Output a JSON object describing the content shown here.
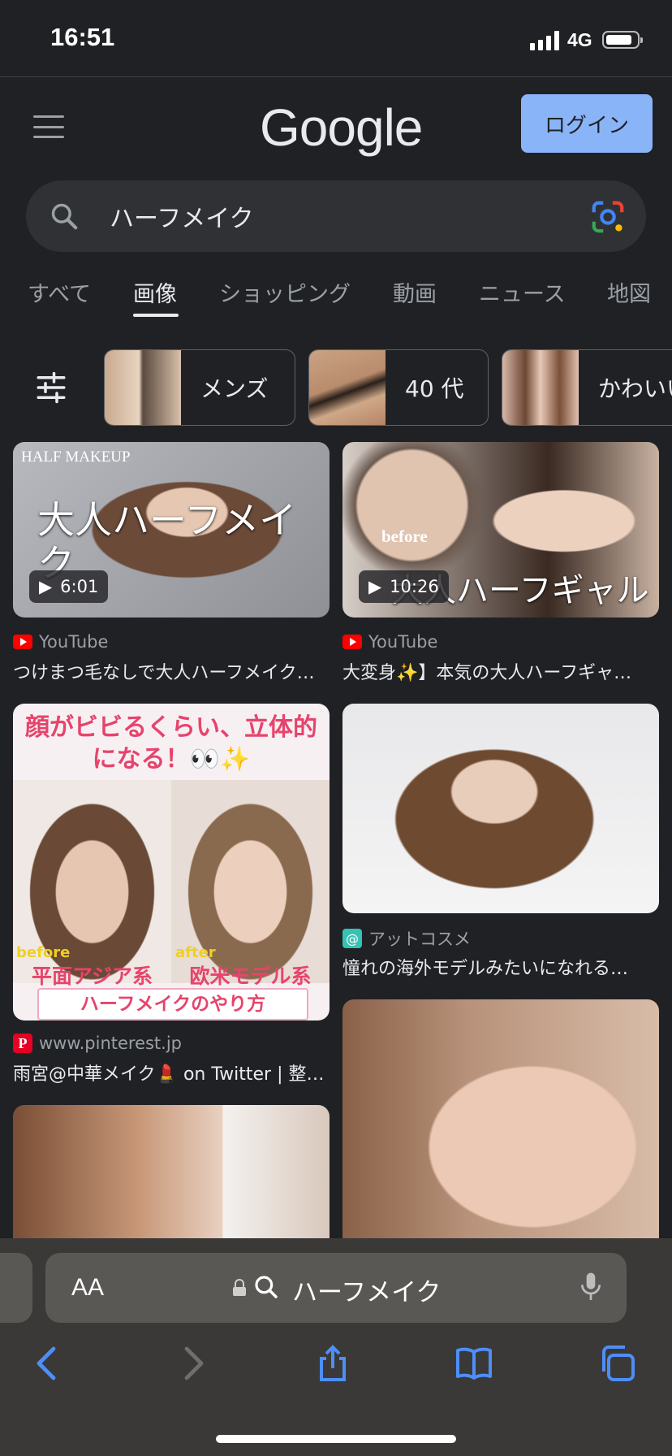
{
  "status_bar": {
    "time": "16:51",
    "network": "4G"
  },
  "header": {
    "logo": "Google",
    "login_label": "ログイン"
  },
  "search": {
    "query": "ハーフメイク"
  },
  "tabs": [
    {
      "label": "すべて"
    },
    {
      "label": "画像"
    },
    {
      "label": "ショッピング"
    },
    {
      "label": "動画"
    },
    {
      "label": "ニュース"
    },
    {
      "label": "地図"
    }
  ],
  "active_tab": "画像",
  "chips": [
    {
      "label": "メンズ"
    },
    {
      "label": "40 代"
    },
    {
      "label": "かわいい"
    }
  ],
  "results": [
    {
      "image_text": "HALF MAKEUP",
      "image_caption": "大人ハーフメイク",
      "duration": "6:01",
      "source": "YouTube",
      "title": "つけまつ毛なしで大人ハーフメイク…"
    },
    {
      "image_text": "before",
      "image_caption": "大人ハーフギャル",
      "duration": "10:26",
      "source": "YouTube",
      "title": "大変身✨】本気の大人ハーフギャ…"
    },
    {
      "image_text": "顔がビビるくらい、立体的になる！👀✨",
      "before_label": "before",
      "after_label": "after",
      "before_caption": "平面アジア系",
      "after_caption": "欧米モデル系",
      "bottom_caption": "ハーフメイクのやり方",
      "source": "www.pinterest.jp",
      "title": "雨宮@中華メイク💄 on Twitter | 整…"
    },
    {
      "source": "アットコスメ",
      "title": "憧れの海外モデルみたいになれる…"
    }
  ],
  "address_bar": {
    "aa": "AA",
    "text": "ハーフメイク"
  },
  "colors": {
    "background": "#202124",
    "accent": "#8ab4f8",
    "youtube": "#ff0000",
    "pinterest": "#e60023"
  }
}
